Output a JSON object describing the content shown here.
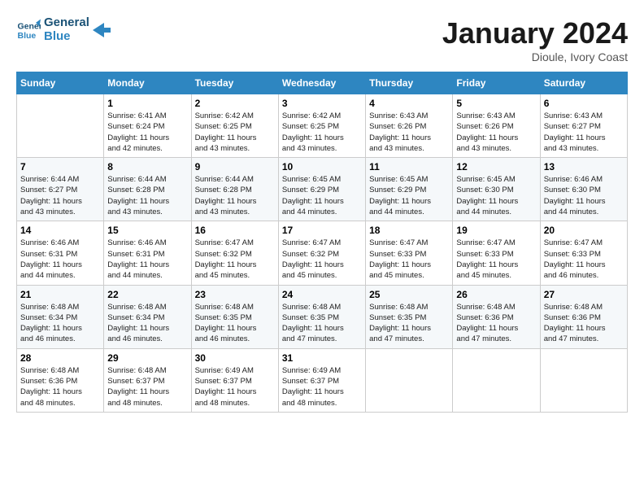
{
  "logo": {
    "line1": "General",
    "line2": "Blue"
  },
  "title": "January 2024",
  "location": "Dioule, Ivory Coast",
  "days_of_week": [
    "Sunday",
    "Monday",
    "Tuesday",
    "Wednesday",
    "Thursday",
    "Friday",
    "Saturday"
  ],
  "weeks": [
    [
      {
        "day": "",
        "info": ""
      },
      {
        "day": "1",
        "info": "Sunrise: 6:41 AM\nSunset: 6:24 PM\nDaylight: 11 hours\nand 42 minutes."
      },
      {
        "day": "2",
        "info": "Sunrise: 6:42 AM\nSunset: 6:25 PM\nDaylight: 11 hours\nand 43 minutes."
      },
      {
        "day": "3",
        "info": "Sunrise: 6:42 AM\nSunset: 6:25 PM\nDaylight: 11 hours\nand 43 minutes."
      },
      {
        "day": "4",
        "info": "Sunrise: 6:43 AM\nSunset: 6:26 PM\nDaylight: 11 hours\nand 43 minutes."
      },
      {
        "day": "5",
        "info": "Sunrise: 6:43 AM\nSunset: 6:26 PM\nDaylight: 11 hours\nand 43 minutes."
      },
      {
        "day": "6",
        "info": "Sunrise: 6:43 AM\nSunset: 6:27 PM\nDaylight: 11 hours\nand 43 minutes."
      }
    ],
    [
      {
        "day": "7",
        "info": "Sunrise: 6:44 AM\nSunset: 6:27 PM\nDaylight: 11 hours\nand 43 minutes."
      },
      {
        "day": "8",
        "info": "Sunrise: 6:44 AM\nSunset: 6:28 PM\nDaylight: 11 hours\nand 43 minutes."
      },
      {
        "day": "9",
        "info": "Sunrise: 6:44 AM\nSunset: 6:28 PM\nDaylight: 11 hours\nand 43 minutes."
      },
      {
        "day": "10",
        "info": "Sunrise: 6:45 AM\nSunset: 6:29 PM\nDaylight: 11 hours\nand 44 minutes."
      },
      {
        "day": "11",
        "info": "Sunrise: 6:45 AM\nSunset: 6:29 PM\nDaylight: 11 hours\nand 44 minutes."
      },
      {
        "day": "12",
        "info": "Sunrise: 6:45 AM\nSunset: 6:30 PM\nDaylight: 11 hours\nand 44 minutes."
      },
      {
        "day": "13",
        "info": "Sunrise: 6:46 AM\nSunset: 6:30 PM\nDaylight: 11 hours\nand 44 minutes."
      }
    ],
    [
      {
        "day": "14",
        "info": "Sunrise: 6:46 AM\nSunset: 6:31 PM\nDaylight: 11 hours\nand 44 minutes."
      },
      {
        "day": "15",
        "info": "Sunrise: 6:46 AM\nSunset: 6:31 PM\nDaylight: 11 hours\nand 44 minutes."
      },
      {
        "day": "16",
        "info": "Sunrise: 6:47 AM\nSunset: 6:32 PM\nDaylight: 11 hours\nand 45 minutes."
      },
      {
        "day": "17",
        "info": "Sunrise: 6:47 AM\nSunset: 6:32 PM\nDaylight: 11 hours\nand 45 minutes."
      },
      {
        "day": "18",
        "info": "Sunrise: 6:47 AM\nSunset: 6:33 PM\nDaylight: 11 hours\nand 45 minutes."
      },
      {
        "day": "19",
        "info": "Sunrise: 6:47 AM\nSunset: 6:33 PM\nDaylight: 11 hours\nand 45 minutes."
      },
      {
        "day": "20",
        "info": "Sunrise: 6:47 AM\nSunset: 6:33 PM\nDaylight: 11 hours\nand 46 minutes."
      }
    ],
    [
      {
        "day": "21",
        "info": "Sunrise: 6:48 AM\nSunset: 6:34 PM\nDaylight: 11 hours\nand 46 minutes."
      },
      {
        "day": "22",
        "info": "Sunrise: 6:48 AM\nSunset: 6:34 PM\nDaylight: 11 hours\nand 46 minutes."
      },
      {
        "day": "23",
        "info": "Sunrise: 6:48 AM\nSunset: 6:35 PM\nDaylight: 11 hours\nand 46 minutes."
      },
      {
        "day": "24",
        "info": "Sunrise: 6:48 AM\nSunset: 6:35 PM\nDaylight: 11 hours\nand 47 minutes."
      },
      {
        "day": "25",
        "info": "Sunrise: 6:48 AM\nSunset: 6:35 PM\nDaylight: 11 hours\nand 47 minutes."
      },
      {
        "day": "26",
        "info": "Sunrise: 6:48 AM\nSunset: 6:36 PM\nDaylight: 11 hours\nand 47 minutes."
      },
      {
        "day": "27",
        "info": "Sunrise: 6:48 AM\nSunset: 6:36 PM\nDaylight: 11 hours\nand 47 minutes."
      }
    ],
    [
      {
        "day": "28",
        "info": "Sunrise: 6:48 AM\nSunset: 6:36 PM\nDaylight: 11 hours\nand 48 minutes."
      },
      {
        "day": "29",
        "info": "Sunrise: 6:48 AM\nSunset: 6:37 PM\nDaylight: 11 hours\nand 48 minutes."
      },
      {
        "day": "30",
        "info": "Sunrise: 6:49 AM\nSunset: 6:37 PM\nDaylight: 11 hours\nand 48 minutes."
      },
      {
        "day": "31",
        "info": "Sunrise: 6:49 AM\nSunset: 6:37 PM\nDaylight: 11 hours\nand 48 minutes."
      },
      {
        "day": "",
        "info": ""
      },
      {
        "day": "",
        "info": ""
      },
      {
        "day": "",
        "info": ""
      }
    ]
  ]
}
